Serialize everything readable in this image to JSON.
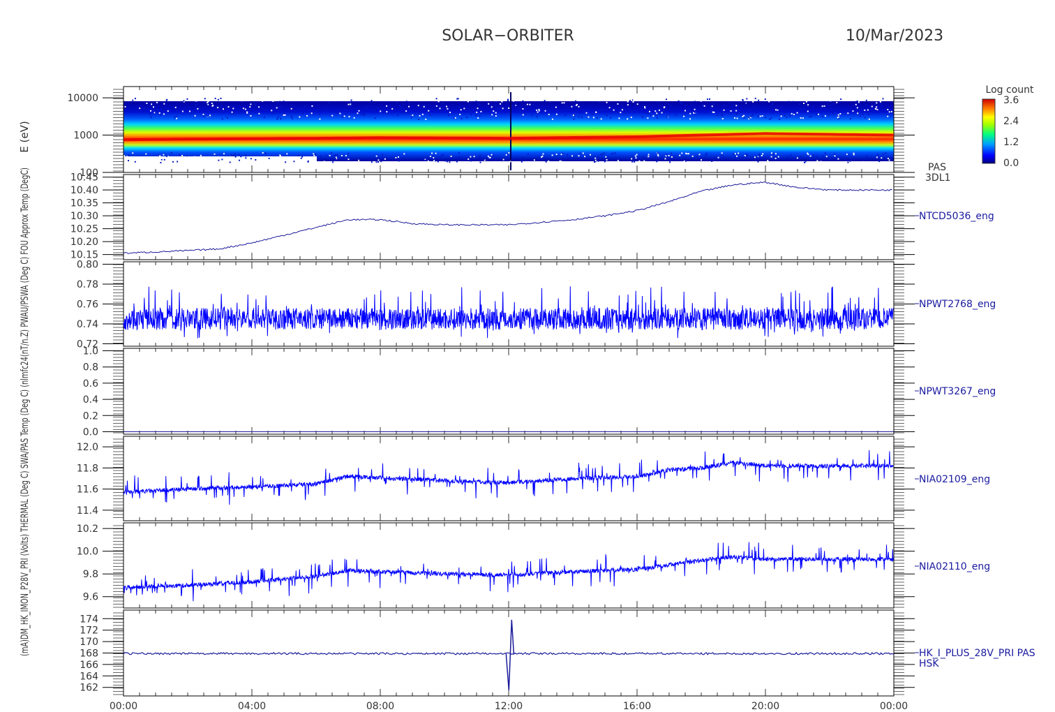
{
  "header": {
    "mission": "SOLAR−ORBITER",
    "date": "10/Mar/2023"
  },
  "left_labels": {
    "spectrogram": "E (eV)",
    "composite": "(mA)DM_HK_IMON_P28V_PRI (Volts) THERMAL (Deg C) SWA/PAS Temp (Deg C) (nlmfc24(nT/n.Z) PWAU/PSWA (Deg C) FOU Approx Temp (DegC)"
  },
  "spectrogram": {
    "colorbar_title": "Log count",
    "colorbar_ticks": [
      "3.6",
      "2.4",
      "1.2",
      "0.0"
    ],
    "labels": [
      "PAS",
      "3DL1"
    ]
  },
  "time_axis": {
    "ticks": [
      "00:00",
      "04:00",
      "08:00",
      "12:00",
      "16:00",
      "20:00",
      "00:00"
    ]
  },
  "chart_data": [
    {
      "type": "heatmap",
      "name_labels": [
        "PAS",
        "3DL1"
      ],
      "ylabel": "E (eV)",
      "yscale": "log",
      "ylim": [
        100,
        20000
      ],
      "yticks": [
        "10000",
        "1000",
        "100"
      ],
      "x_hours": [
        0,
        2,
        4,
        6,
        8,
        10,
        12,
        14,
        16,
        18,
        20,
        22,
        24
      ],
      "peak_energy_eV": [
        750,
        780,
        800,
        820,
        850,
        840,
        820,
        860,
        900,
        1000,
        1100,
        1050,
        1000
      ],
      "colorbar": {
        "label": "Log count",
        "range": [
          0.0,
          3.6
        ]
      }
    },
    {
      "type": "line",
      "label": "NTCD5036_eng",
      "yticks": [
        "10.45",
        "10.40",
        "10.35",
        "10.30",
        "10.25",
        "10.20",
        "10.15"
      ],
      "ylim": [
        10.13,
        10.46
      ],
      "x_hours": [
        0,
        1,
        2,
        3,
        4,
        5,
        6,
        7,
        8,
        9,
        10,
        11,
        12,
        13,
        14,
        15,
        16,
        17,
        18,
        19,
        20,
        21,
        22,
        23,
        24
      ],
      "values": [
        10.155,
        10.16,
        10.165,
        10.172,
        10.195,
        10.225,
        10.255,
        10.285,
        10.285,
        10.27,
        10.265,
        10.265,
        10.265,
        10.275,
        10.285,
        10.3,
        10.32,
        10.355,
        10.395,
        10.42,
        10.43,
        10.41,
        10.4,
        10.4,
        10.4
      ]
    },
    {
      "type": "line",
      "label": "NPWT2768_eng",
      "yticks": [
        "0.80",
        "0.78",
        "0.76",
        "0.74",
        "0.72"
      ],
      "ylim": [
        0.7175,
        0.8025
      ],
      "baseline": 0.745,
      "noise_low": 0.725,
      "noise_high": 0.785
    },
    {
      "type": "line",
      "label": "NPWT3267_eng",
      "yticks": [
        "1.0",
        "0.8",
        "0.6",
        "0.4",
        "0.2",
        "0.0"
      ],
      "ylim": [
        -0.03,
        1.03
      ],
      "values": [
        0.0,
        0.0
      ]
    },
    {
      "type": "line",
      "label": "NIA02109_eng",
      "yticks": [
        "12.0",
        "11.8",
        "11.6",
        "11.4"
      ],
      "ylim": [
        11.3,
        12.1
      ],
      "x_hours": [
        0,
        2,
        4,
        6,
        7,
        10,
        12,
        14,
        16,
        17,
        18,
        19,
        20,
        24
      ],
      "values": [
        11.57,
        11.6,
        11.62,
        11.65,
        11.72,
        11.68,
        11.66,
        11.7,
        11.72,
        11.78,
        11.8,
        11.85,
        11.82,
        11.82
      ]
    },
    {
      "type": "line",
      "label": "NIA02110_eng",
      "yticks": [
        "10.2",
        "10.0",
        "9.8",
        "9.6"
      ],
      "ylim": [
        9.5,
        10.25
      ],
      "x_hours": [
        0,
        2,
        4,
        6,
        7,
        10,
        12,
        14,
        16,
        17,
        18,
        19,
        20,
        24
      ],
      "values": [
        9.68,
        9.7,
        9.73,
        9.78,
        9.83,
        9.8,
        9.79,
        9.82,
        9.84,
        9.88,
        9.92,
        9.95,
        9.93,
        9.93
      ]
    },
    {
      "type": "line",
      "label_lines": [
        "HK_I_PLUS_28V_PRI PAS",
        "HSK"
      ],
      "yticks": [
        "174",
        "172",
        "170",
        "168",
        "166",
        "164",
        "162"
      ],
      "ylim": [
        160.5,
        175.5
      ],
      "baseline": 167.9,
      "spike": {
        "x_hour": 12.05,
        "min": 161.5,
        "max": 173.8
      }
    }
  ]
}
